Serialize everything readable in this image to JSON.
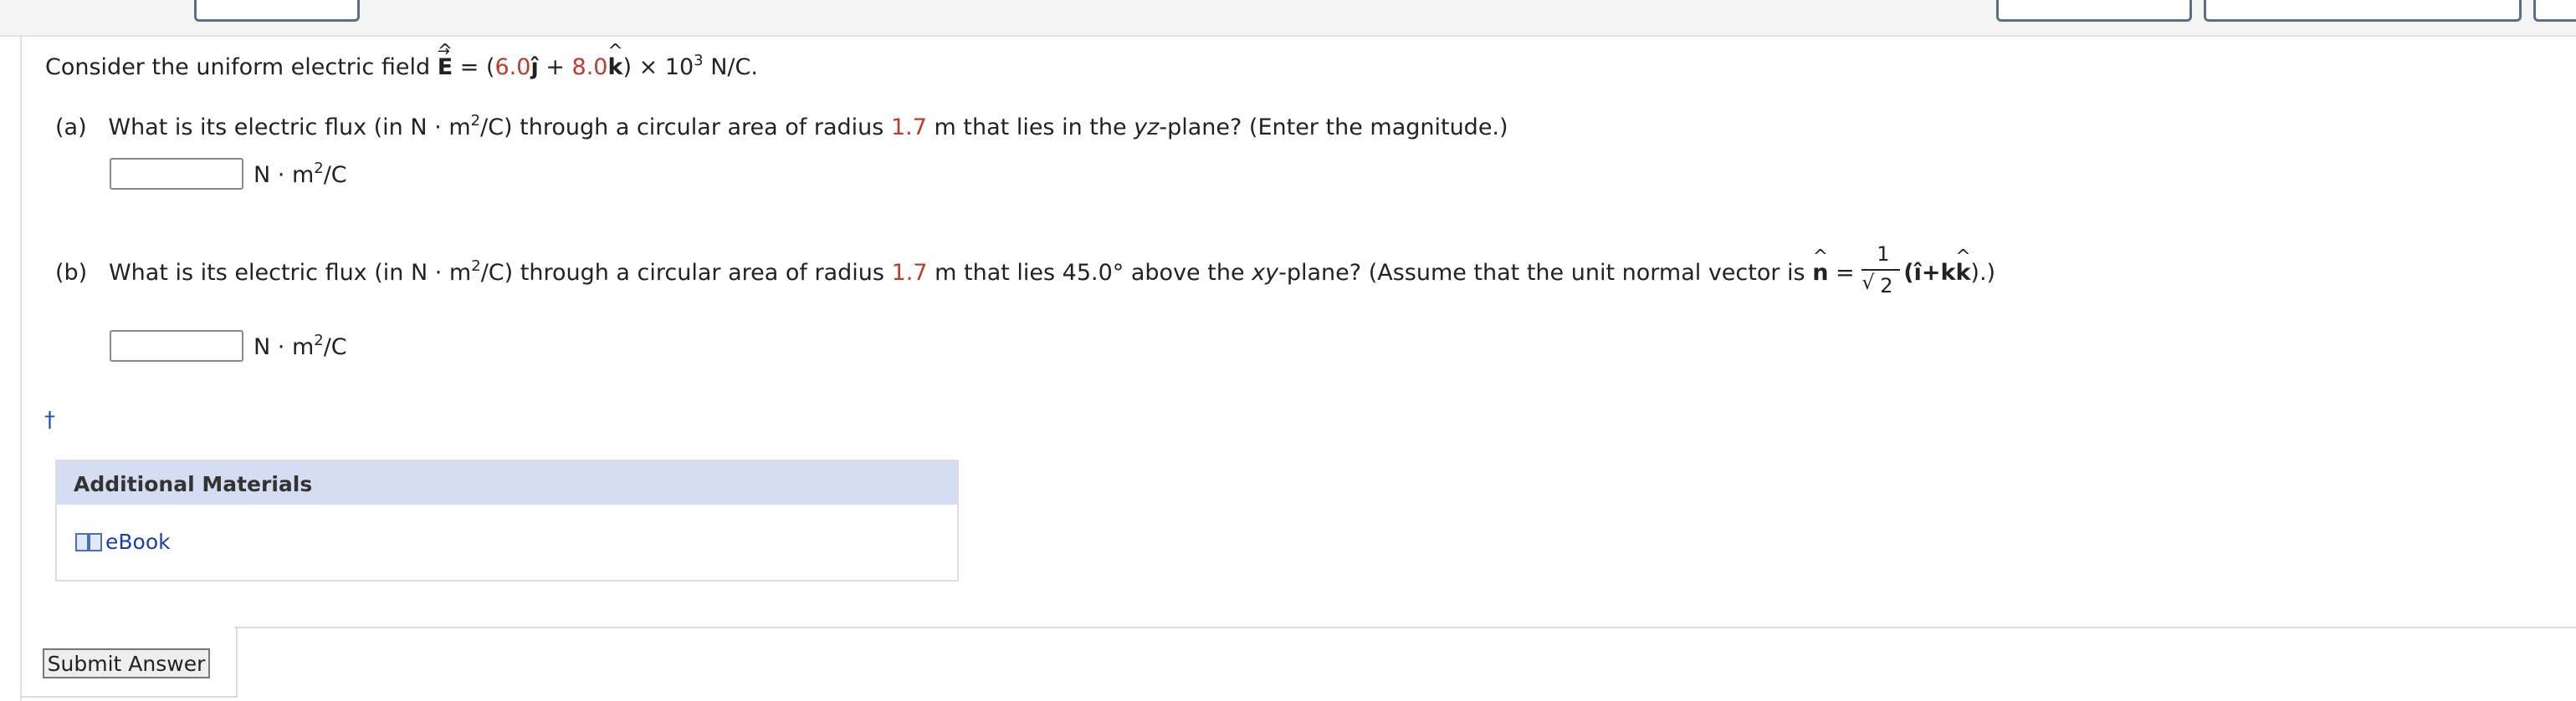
{
  "intro": {
    "prefix": "Consider the uniform electric field",
    "field_symbol": "E",
    "equals": "=",
    "open_paren": "(",
    "jcoef": "6.0",
    "jhat": "ĵ",
    "plus": "+",
    "kcoef": "8.0",
    "khat": "k",
    "close_paren": ")",
    "times": "× 10",
    "exp": "3",
    "unit": "N/C."
  },
  "part_a": {
    "label": "(a)",
    "q1": "What is its electric flux (in N · m",
    "q1_sup": "2",
    "q2": "/C) through a circular area of radius",
    "radius": "1.7",
    "q3": "m that lies in the",
    "plane": "yz",
    "q4": "-plane? (Enter the magnitude.)",
    "input_value": "",
    "unit_base": "N · m",
    "unit_sup": "2",
    "unit_tail": "/C"
  },
  "part_b": {
    "label": "(b)",
    "q1": "What is its electric flux (in N · m",
    "q1_sup": "2",
    "q2": "/C) through a circular area of radius",
    "radius": "1.7",
    "q3": "m that lies 45.0° above the",
    "plane": "xy",
    "q4": "-plane? (Assume that the unit normal vector is",
    "nhat": "n",
    "q5": "=",
    "frac_num": "1",
    "frac_den": "2",
    "q6": "(î+k",
    "q7": ").)",
    "input_value": "",
    "unit_base": "N · m",
    "unit_sup": "2",
    "unit_tail": "/C"
  },
  "dagger": "†",
  "additional": {
    "title": "Additional Materials",
    "ebook": "eBook"
  },
  "submit_label": "Submit Answer"
}
